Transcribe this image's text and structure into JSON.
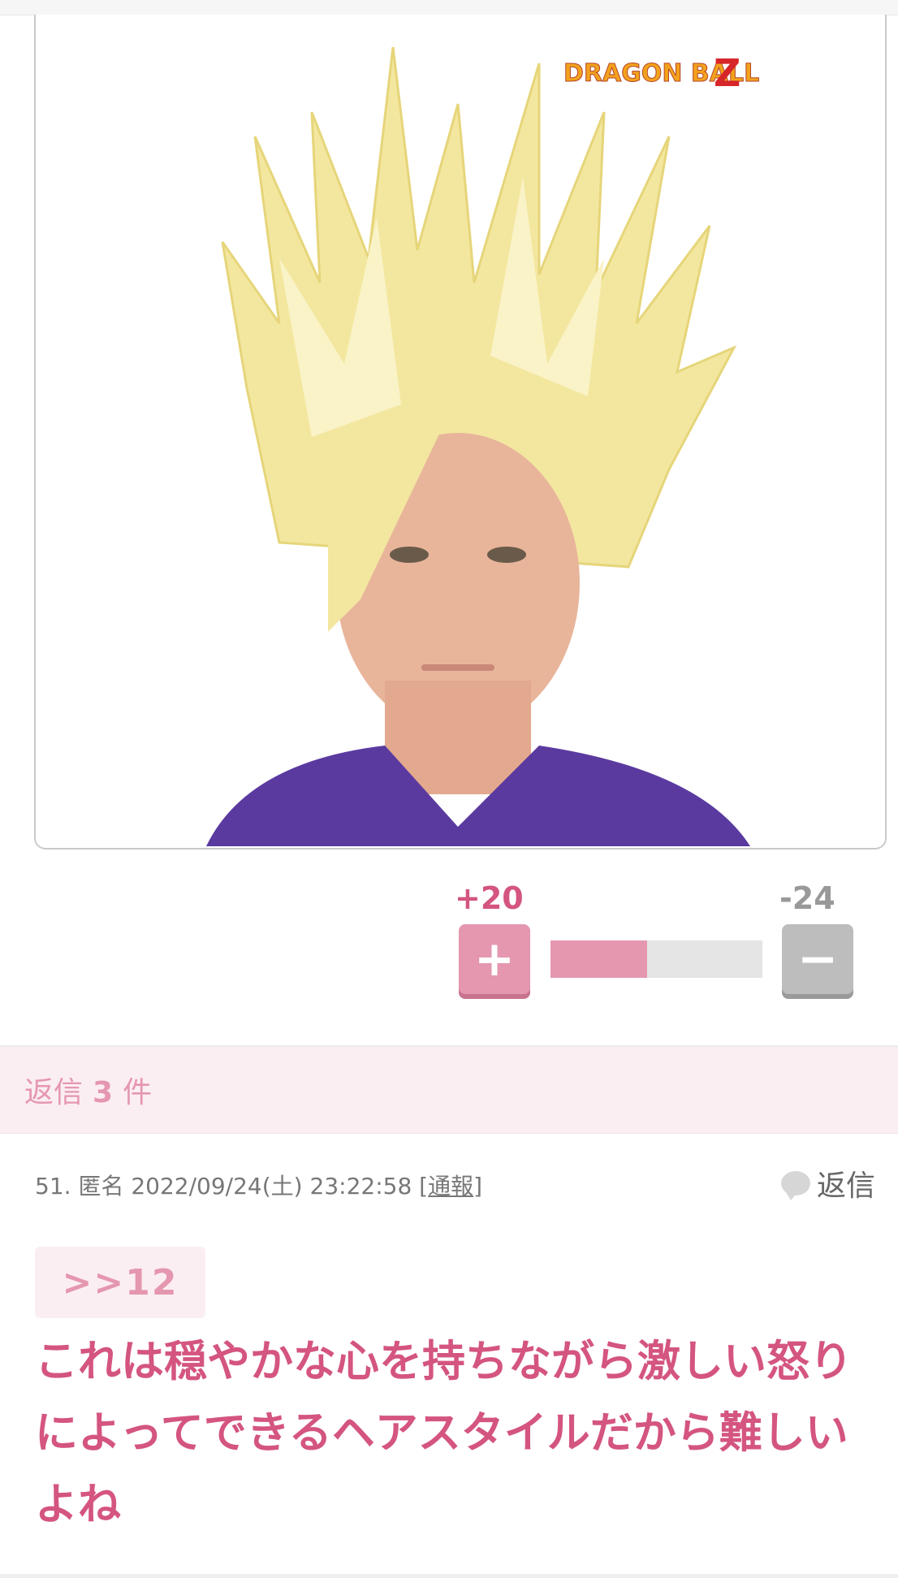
{
  "image": {
    "alt": "",
    "logo_text": "DRAGON BALL",
    "logo_z": "Z"
  },
  "votes": {
    "plus_count": "+20",
    "minus_count": "-24",
    "plus_label": "+",
    "minus_label": "−",
    "plus_fraction": 0.455
  },
  "replies": {
    "prefix": "返信",
    "count": "3",
    "suffix": "件"
  },
  "comment": {
    "number": "51.",
    "author": "匿名",
    "date": "2022/09/24(土)",
    "time": "23:22:58",
    "report_open": "[",
    "report_label": "通報",
    "report_close": "]",
    "reply_label": "返信",
    "anchor": ">>12",
    "body": "これは穏やかな心を持ちながら激しい怒りによってできるヘアスタイルだから難しいよね"
  },
  "colors": {
    "accent": "#d4557f",
    "pink_light": "#e597b0",
    "band_bg": "#fbeef2",
    "minus_gray": "#bdbdbd"
  }
}
